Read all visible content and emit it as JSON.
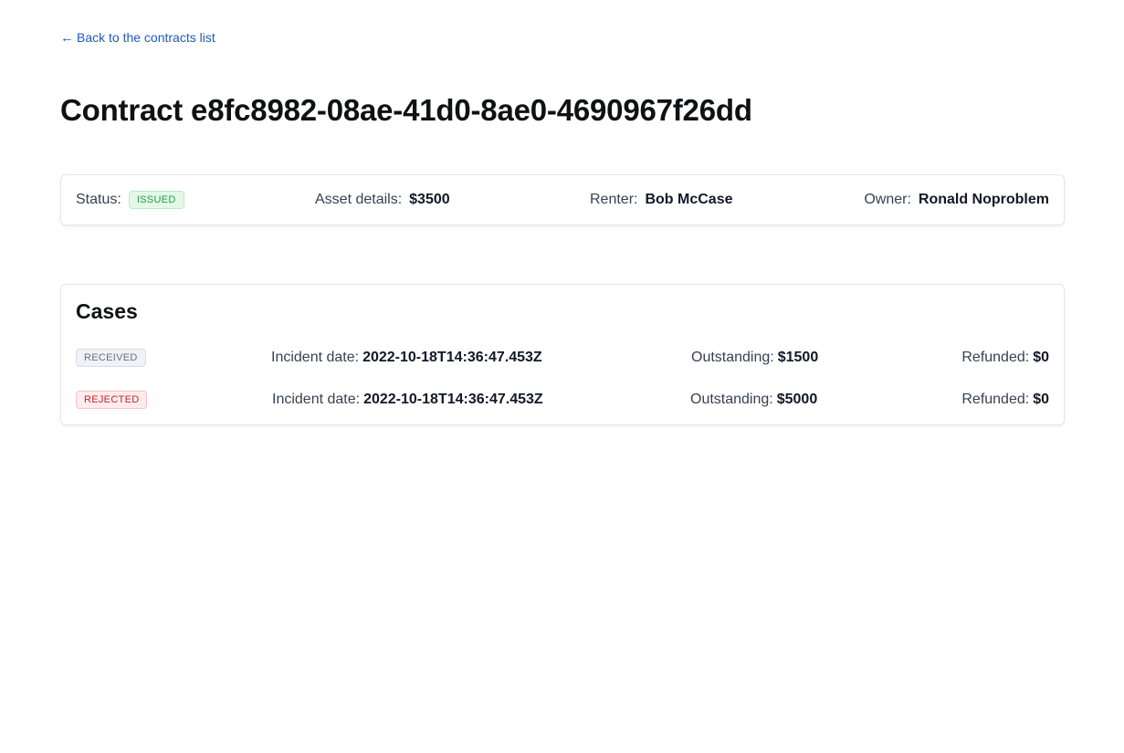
{
  "nav": {
    "back_arrow": "←",
    "back_label": "Back to the contracts list"
  },
  "page": {
    "title": "Contract e8fc8982-08ae-41d0-8ae0-4690967f26dd"
  },
  "summary": {
    "status_label": "Status:",
    "status_value": "ISSUED",
    "asset_label": "Asset details:",
    "asset_value": "$3500",
    "renter_label": "Renter:",
    "renter_value": "Bob McCase",
    "owner_label": "Owner:",
    "owner_value": "Ronald Noproblem"
  },
  "cases": {
    "title": "Cases",
    "incident_label": "Incident date:",
    "outstanding_label": "Outstanding:",
    "refunded_label": "Refunded:",
    "rows": [
      {
        "status": "RECEIVED",
        "incident_date": "2022-10-18T14:36:47.453Z",
        "outstanding": "$1500",
        "refunded": "$0"
      },
      {
        "status": "REJECTED",
        "incident_date": "2022-10-18T14:36:47.453Z",
        "outstanding": "$5000",
        "refunded": "$0"
      }
    ]
  },
  "colors": {
    "link": "#1d5bb8",
    "issued_badge": "#1e9e45",
    "received_badge": "#6b7280",
    "rejected_badge": "#c0282e"
  }
}
